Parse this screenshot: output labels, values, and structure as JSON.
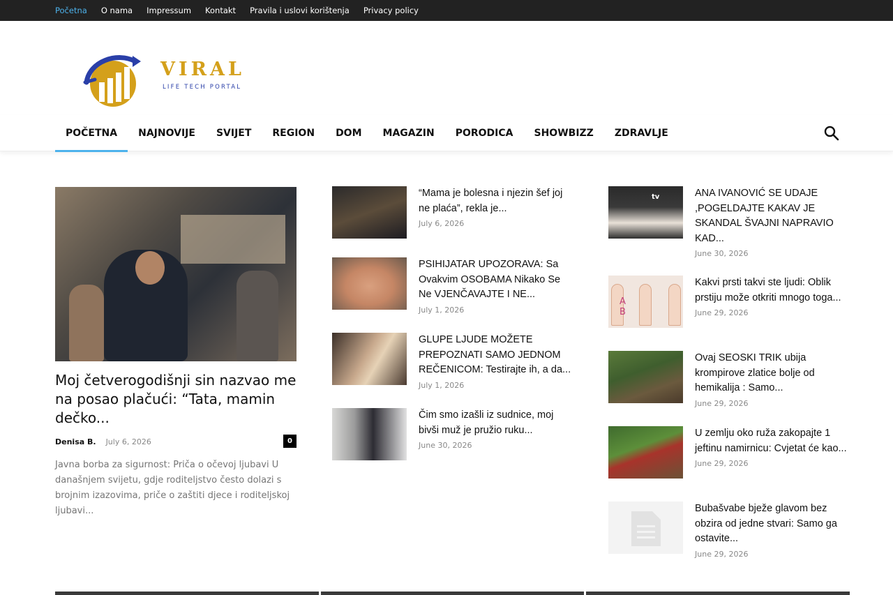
{
  "topbar": {
    "links": [
      "Početna",
      "O nama",
      "Impressum",
      "Kontakt",
      "Pravila i uslovi korištenja",
      "Privacy policy"
    ]
  },
  "logo": {
    "word": "VIRAL",
    "tagline": "LIFE TECH PORTAL",
    "colors": {
      "gold": "#d4a01b",
      "blue": "#2a3fa8"
    }
  },
  "nav": {
    "items": [
      "POČETNA",
      "NAJNOVIJE",
      "SVIJET",
      "REGION",
      "DOM",
      "MAGAZIN",
      "PORODICA",
      "SHOWBIZZ",
      "ZDRAVLJE"
    ],
    "active_index": 0,
    "search_icon": "search-icon",
    "accent": "#4db2ec"
  },
  "featured": {
    "title": "Moj četverogodišnji sin nazvao me na posao plačući: “Tata, mamin dečko...",
    "author": "Denisa B.",
    "date": "July 6, 2026",
    "comments": "0",
    "excerpt": "Javna borba za sigurnost: Priča o očevoj ljubavi U današnjem svijetu, gdje roditeljstvo često dolazi s brojnim izazovima, priče o zaštiti djece i roditeljskoj ljubavi..."
  },
  "column2": [
    {
      "title": "“Mama je bolesna i njezin šef joj ne plaća”, rekla je...",
      "date": "July 6, 2026"
    },
    {
      "title": "PSIHIJATAR UPOZORAVA: Sa Ovakvim OSOBAMA Nikako Se Ne VJENČAVAJTE I NE...",
      "date": "July 1, 2026"
    },
    {
      "title": "GLUPE LJUDE MOŽETE PREPOZNATI SAMO JEDNOM REČENICOM: Testirajte ih, a da...",
      "date": "July 1, 2026"
    },
    {
      "title": "Čim smo izašli iz sudnice, moj bivši muž je pružio ruku...",
      "date": "June 30, 2026"
    }
  ],
  "column3": [
    {
      "title": "ANA IVANOVIĆ SE UDAJE ,POGELDAJTE KAKAV JE SKANDAL ŠVAJNI NAPRAVIO KAD...",
      "date": "June 30, 2026",
      "thumb_text": "tv"
    },
    {
      "title": "Kakvi prsti takvi ste ljudi: Oblik prstiju može otkriti mnogo toga...",
      "date": "June 29, 2026",
      "thumb_text": "A B"
    },
    {
      "title": "Ovaj SEOSKI TRIK ubija krompirove zlatice bolje od hemikalija : Samo...",
      "date": "June 29, 2026"
    },
    {
      "title": "U zemlju oko ruža zakopajte 1 jeftinu namirnicu: Cvjetat će kao...",
      "date": "June 29, 2026"
    },
    {
      "title": "Bubašvabe bježe glavom bez obzira od jedne stvari: Samo ga ostavite...",
      "date": "June 29, 2026"
    }
  ]
}
